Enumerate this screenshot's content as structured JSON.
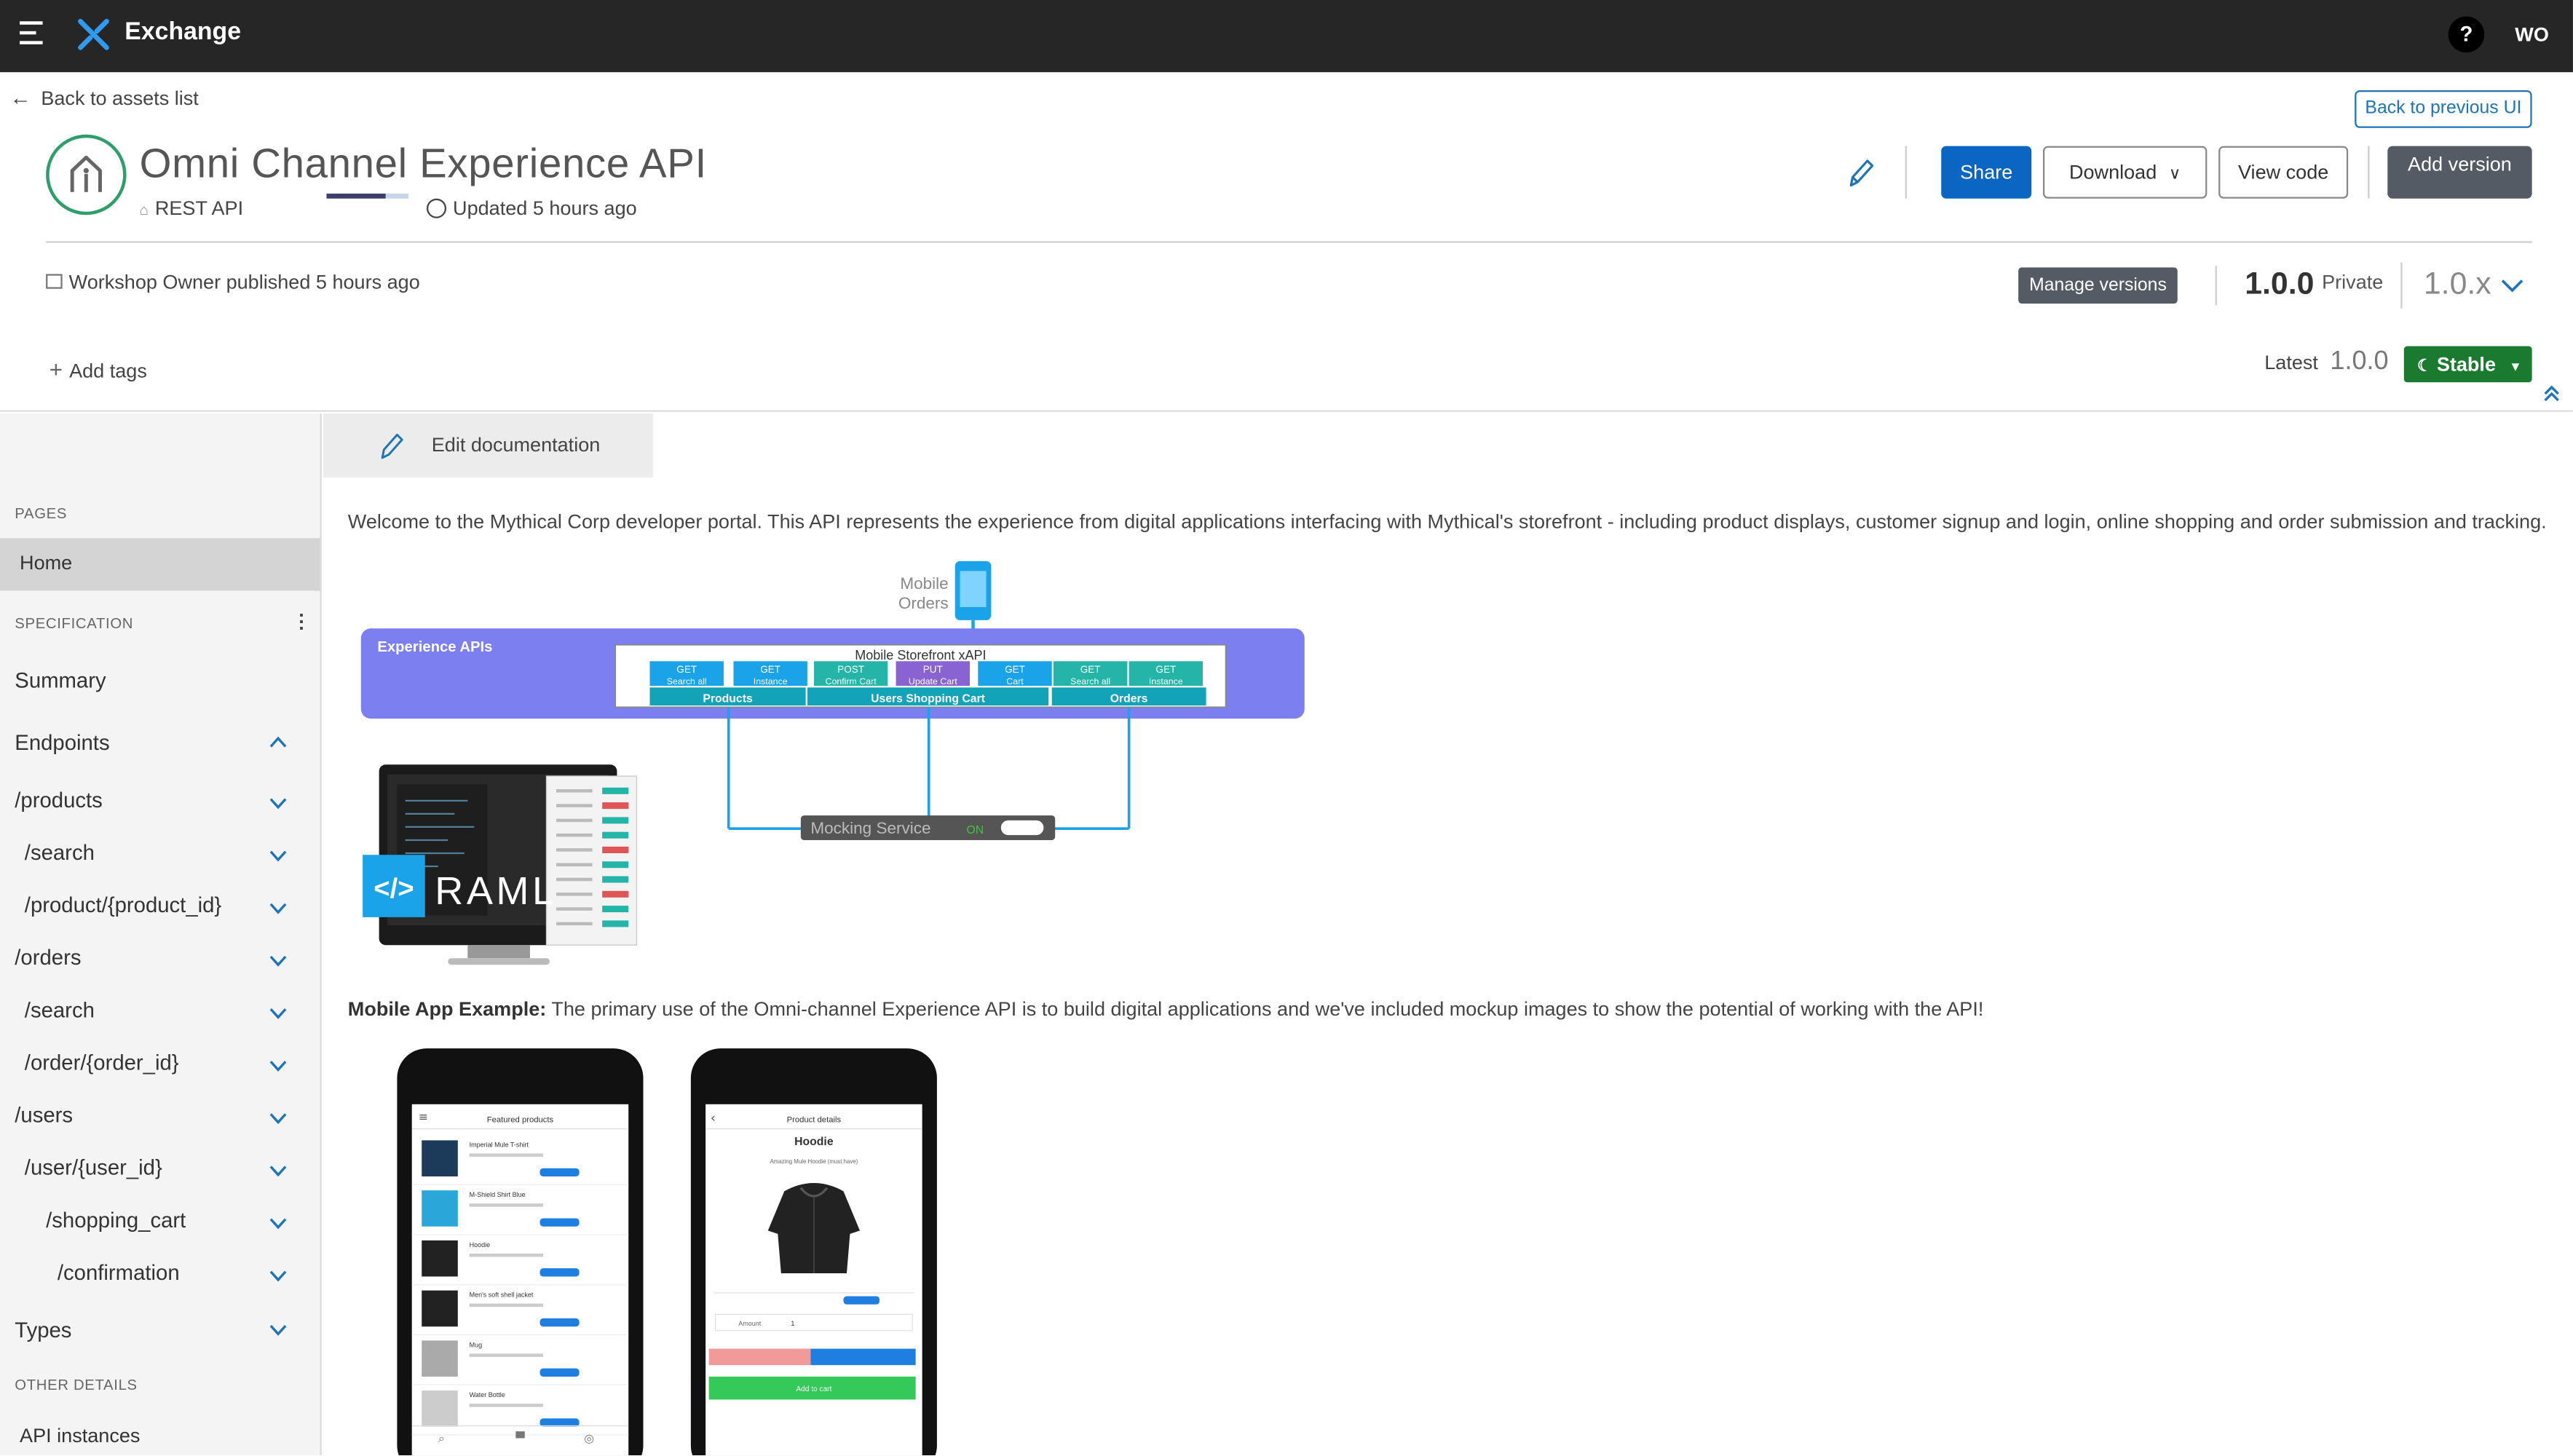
{
  "topbar": {
    "app_name": "Exchange",
    "help_label": "?",
    "avatar_initials": "WO"
  },
  "nav": {
    "back_label": "Back to assets list",
    "back_prev_ui": "Back to previous UI"
  },
  "asset": {
    "title": "Omni Channel Experience API",
    "type": "REST API",
    "updated": "Updated 5 hours ago",
    "published": "Workshop Owner published 5 hours ago",
    "add_tags": "Add tags"
  },
  "actions": {
    "share": "Share",
    "download": "Download",
    "view_code": "View code",
    "add_version": "Add version"
  },
  "version": {
    "manage_label": "Manage versions",
    "number": "1.0.0",
    "visibility": "Private",
    "selector": "1.0.x",
    "latest_label": "Latest",
    "latest_value": "1.0.0",
    "stability": "Stable"
  },
  "sidebar": {
    "pages_header": "PAGES",
    "home": "Home",
    "spec_header": "SPECIFICATION",
    "summary": "Summary",
    "endpoints": "Endpoints",
    "endpoint_items": [
      "/products",
      "/search",
      "/product/{product_id}",
      "/orders",
      "/search",
      "/order/{order_id}",
      "/users",
      "/user/{user_id}",
      "/shopping_cart",
      "/confirmation"
    ],
    "types": "Types",
    "other_header": "OTHER DETAILS",
    "api_instances": "API instances"
  },
  "doc": {
    "edit_label": "Edit documentation",
    "welcome": "Welcome to the Mythical Corp developer portal. This API represents the experience from digital applications interfacing with Mythical's storefront - including product displays, customer signup and login, online shopping and order submission and tracking.",
    "mobile_bold": "Mobile App Example:",
    "mobile_text": " The primary use of the Omni-channel Experience API is to build digital applications and we've included mockup images to show the potential of working with the API!"
  },
  "diagram": {
    "mobile_label_1": "Mobile",
    "mobile_label_2": "Orders",
    "box_title": "Experience APIs",
    "xapi_title": "Mobile Storefront xAPI",
    "ops": [
      {
        "verb": "GET",
        "name": "Search all"
      },
      {
        "verb": "GET",
        "name": "Instance"
      },
      {
        "verb": "POST",
        "name": "Confirm Cart"
      },
      {
        "verb": "PUT",
        "name": "Update Cart"
      },
      {
        "verb": "GET",
        "name": "Cart"
      },
      {
        "verb": "GET",
        "name": "Search all"
      },
      {
        "verb": "GET",
        "name": "Instance"
      }
    ],
    "groups": [
      "Products",
      "Users Shopping Cart",
      "Orders"
    ],
    "mocking_label": "Mocking Service",
    "mocking_state": "ON",
    "raml_label": "RAML",
    "code_symbol": "</>"
  },
  "phone1": {
    "header": "Featured products",
    "products": [
      "Imperial Mule T-shirt",
      "M-Shield Shirt Blue",
      "Hoodie",
      "Men's soft shell jacket",
      "Mug",
      "Water Bottle"
    ]
  },
  "phone2": {
    "header": "Product details",
    "title": "Hoodie",
    "subtitle": "Amazing Mule Hoodie (must have)",
    "amount_label": "Amount",
    "amount_value": "1",
    "add_to_cart": "Add to cart"
  },
  "colors": {
    "topbar": "#262626",
    "primary": "#0b66c3",
    "stable": "#1a7a2f",
    "diagram_box": "#7b7ff0",
    "asset_ring": "#2e9f6a"
  }
}
